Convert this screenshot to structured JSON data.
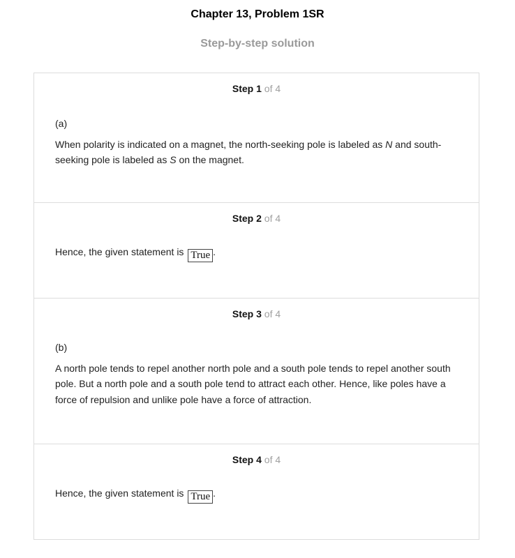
{
  "header": {
    "title": "Chapter 13, Problem 1SR",
    "subtitle": "Step-by-step solution"
  },
  "steps": [
    {
      "word": "Step",
      "number": "1",
      "of": "of 4",
      "part": "(a)",
      "text_pre": "When polarity is indicated on a magnet, the north-seeking pole is labeled as ",
      "var1": "N",
      "text_mid": " and south-seeking pole is labeled as ",
      "var2": "S",
      "text_post": " on the magnet."
    },
    {
      "word": "Step",
      "number": "2",
      "of": "of 4",
      "text": "Hence, the given statement is",
      "answer": "True",
      "end": "."
    },
    {
      "word": "Step",
      "number": "3",
      "of": "of 4",
      "part": "(b)",
      "text": "A north pole tends to repel another north pole and a south pole tends to repel another south pole. But a north pole and a south pole tend to attract each other. Hence, like poles have a force of repulsion and unlike pole have a force of attraction."
    },
    {
      "word": "Step",
      "number": "4",
      "of": "of 4",
      "text": "Hence, the given statement is",
      "answer": "True",
      "end": "."
    }
  ]
}
